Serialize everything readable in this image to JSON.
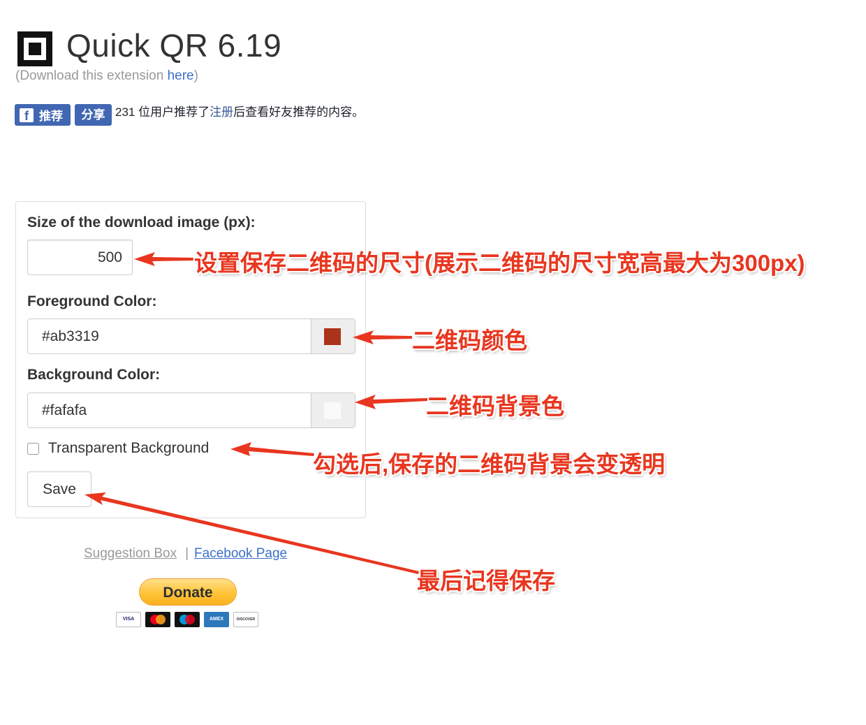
{
  "header": {
    "title": "Quick QR 6.19",
    "download_prefix": "(Download this extension ",
    "download_link": "here",
    "download_suffix": ")"
  },
  "facebook": {
    "like_icon": "f",
    "like_label": "推荐",
    "share_label": "分享",
    "count_text": "231 位用户推荐了",
    "signup_link": "注册",
    "after_text": "后查看好友推荐的内容。"
  },
  "options": {
    "size_label": "Size of the download image (px):",
    "size_value": "500",
    "fg_label": "Foreground Color:",
    "fg_value": "#ab3319",
    "bg_label": "Background Color:",
    "bg_value": "#fafafa",
    "transparent_label": "Transparent Background",
    "transparent_checked": false,
    "save_label": "Save"
  },
  "colors": {
    "foreground": "#ab3319",
    "background": "#fafafa",
    "annotation": "#e8361f"
  },
  "footer": {
    "suggestion": "Suggestion Box",
    "separator": "|",
    "facebook_page": "Facebook Page",
    "donate": "Donate",
    "cards": [
      "VISA",
      "MasterCard",
      "Maestro",
      "AMEX",
      "DISCOVER"
    ]
  },
  "annotations": {
    "size": "设置保存二维码的尺寸(展示二维码的尺寸宽高最大为300px)",
    "fg": "二维码颜色",
    "bg": "二维码背景色",
    "transparent": "勾选后,保存的二维码背景会变透明",
    "save": "最后记得保存"
  }
}
